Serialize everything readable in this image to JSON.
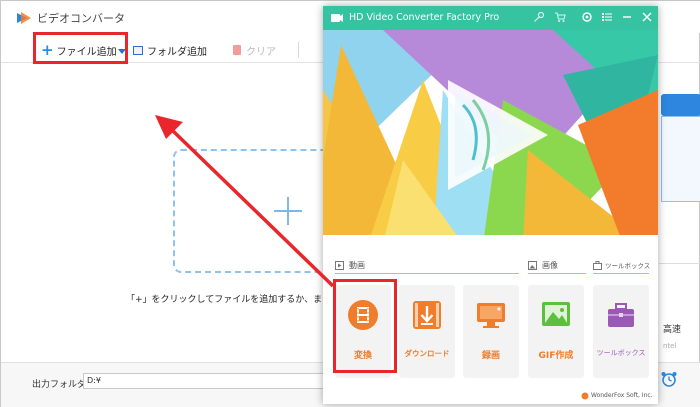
{
  "background_window": {
    "title": "ビデオコンバータ",
    "toolbar": {
      "add_file_label": "ファイル追加",
      "add_folder_label": "フォルダ追加",
      "clear_label": "クリア"
    },
    "dropzone_hint": "「+」をクリックしてファイルを追加するか、またはフ",
    "output_folder_label": "出力フォルダ：",
    "output_folder_value": "D:¥",
    "right_edge_text": "高速",
    "right_edge_small": "ntel"
  },
  "foreground_window": {
    "title": "HD Video Converter Factory Pro",
    "sections": {
      "video": "動画",
      "image": "画像",
      "toolbox": "ツールボックス"
    },
    "tools": [
      {
        "label": "変換",
        "icon": "film-icon"
      },
      {
        "label": "ダウンロード",
        "icon": "download-icon"
      },
      {
        "label": "録画",
        "icon": "monitor-icon"
      },
      {
        "label": "GIF作成",
        "icon": "image-icon"
      },
      {
        "label": "ツールボックス",
        "icon": "toolbox-icon"
      }
    ],
    "copyright": "WonderFox Soft, Inc."
  },
  "colors": {
    "title_bar": "#35c3a1",
    "accent_orange": "#f07d2b",
    "highlight_red": "#e8262b",
    "toolbox_purple": "#9b59b6"
  }
}
